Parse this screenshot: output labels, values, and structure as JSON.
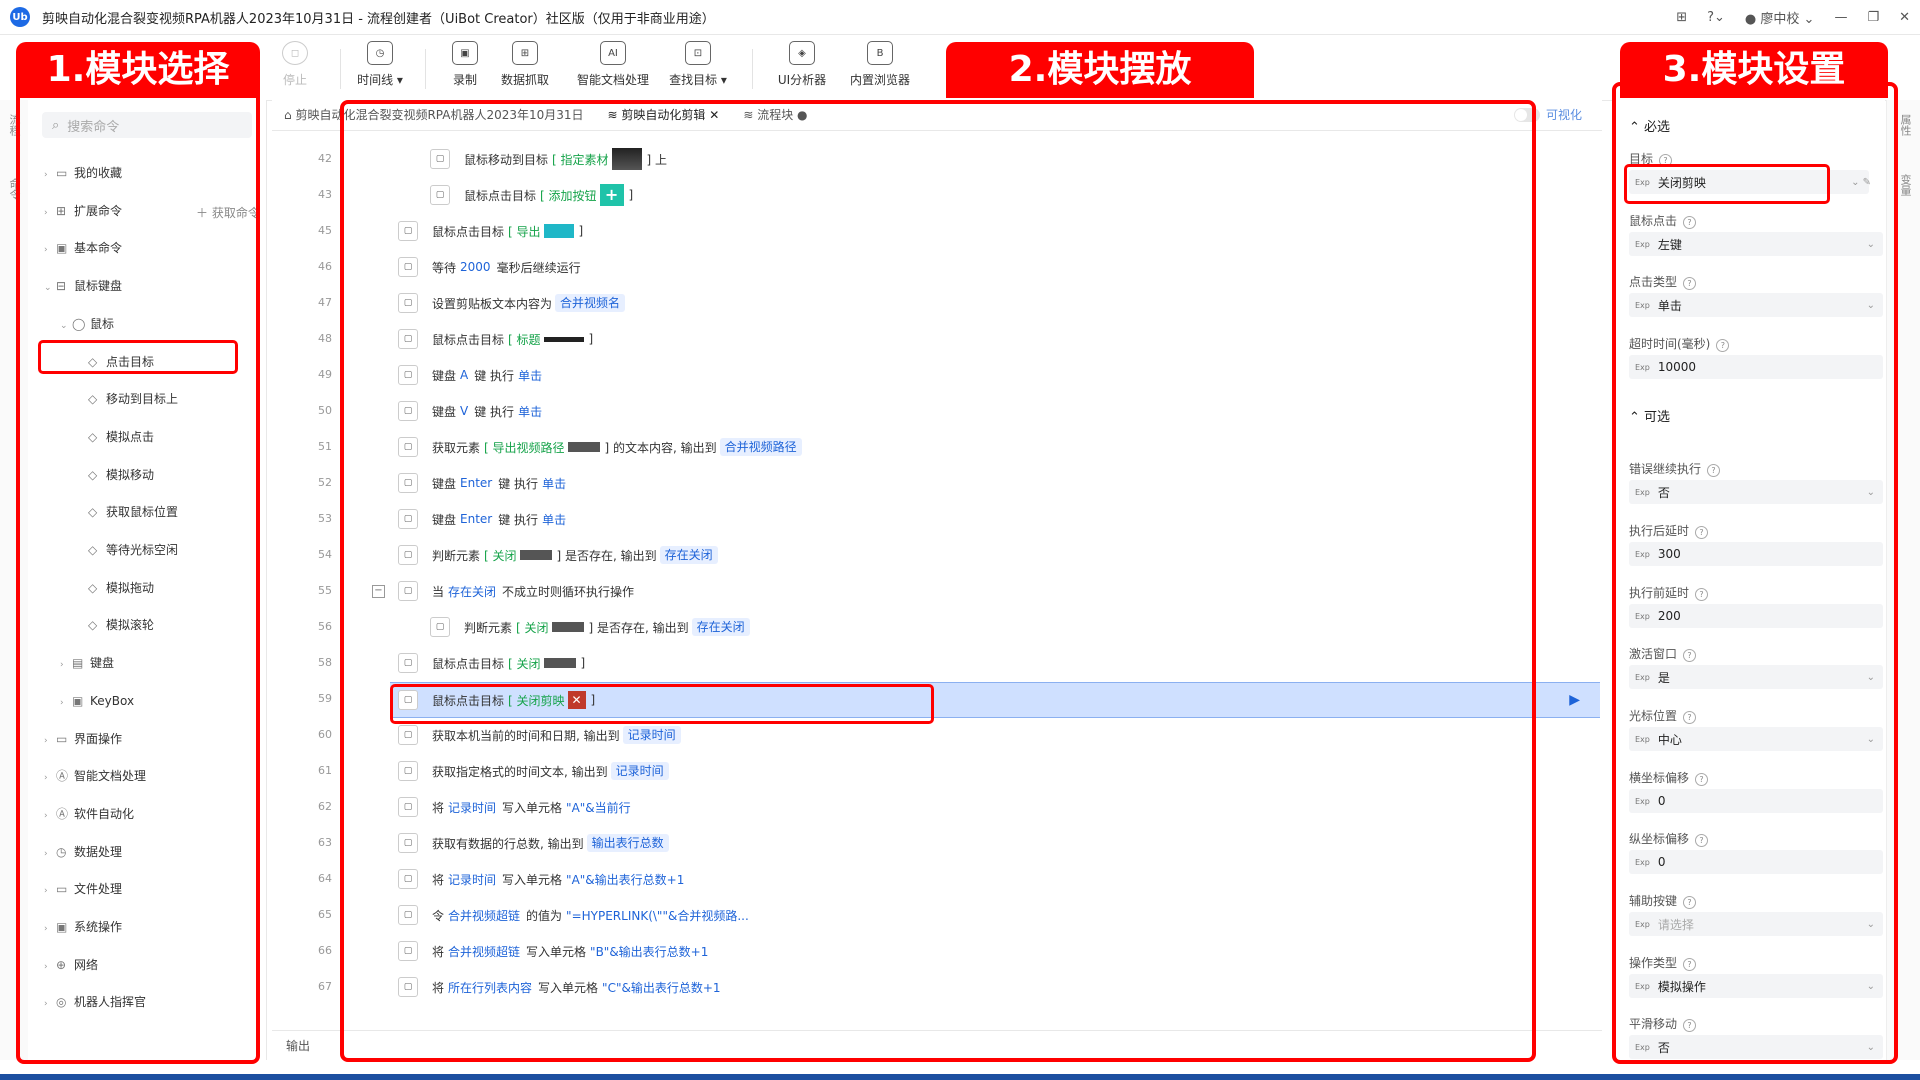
{
  "window": {
    "title": "剪映自动化混合裂变视频RPA机器人2023年10月31日 - 流程创建者（UiBot Creator）社区版（仅用于非商业用途）",
    "logo": "Ub",
    "user": "廖中校"
  },
  "toolbar": {
    "stop": "停止",
    "timeline": "时间线",
    "record": "录制",
    "data_capture": "数据抓取",
    "smart_doc": "智能文档处理",
    "find_target": "查找目标",
    "ui_analyzer": "UI分析器",
    "browser": "内置浏览器",
    "icons": {
      "timeline": "◷",
      "record": "▣",
      "data_capture": "⊞",
      "smart_doc": "AI",
      "find_target": "⊡",
      "ui_analyzer": "◈",
      "browser": "B"
    }
  },
  "annotations": {
    "left": "1.模块选择",
    "center": "2.模块摆放",
    "right": "3.模块设置"
  },
  "left_panel": {
    "search_placeholder": "搜索命令",
    "get_command": "获取命令",
    "tabs": [
      "流程",
      "命令"
    ],
    "tree": [
      {
        "label": "我的收藏",
        "arrow": "›",
        "icon": "▭"
      },
      {
        "label": "扩展命令",
        "arrow": "›",
        "icon": "⊞"
      },
      {
        "label": "基本命令",
        "arrow": "›",
        "icon": "▣"
      },
      {
        "label": "鼠标键盘",
        "arrow": "⌄",
        "icon": "⊟"
      },
      {
        "label": "鼠标",
        "arrow": "⌄",
        "icon": "◯"
      },
      {
        "label": "点击目标",
        "arrow": "",
        "icon": "◇"
      },
      {
        "label": "移动到目标上",
        "arrow": "",
        "icon": "◇"
      },
      {
        "label": "模拟点击",
        "arrow": "",
        "icon": "◇"
      },
      {
        "label": "模拟移动",
        "arrow": "",
        "icon": "◇"
      },
      {
        "label": "获取鼠标位置",
        "arrow": "",
        "icon": "◇"
      },
      {
        "label": "等待光标空闲",
        "arrow": "",
        "icon": "◇"
      },
      {
        "label": "模拟拖动",
        "arrow": "",
        "icon": "◇"
      },
      {
        "label": "模拟滚轮",
        "arrow": "",
        "icon": "◇"
      },
      {
        "label": "键盘",
        "arrow": "›",
        "icon": "▤"
      },
      {
        "label": "KeyBox",
        "arrow": "›",
        "icon": "▣"
      },
      {
        "label": "界面操作",
        "arrow": "›",
        "icon": "▭"
      },
      {
        "label": "智能文档处理",
        "arrow": "›",
        "icon": "Ⓐ"
      },
      {
        "label": "软件自动化",
        "arrow": "›",
        "icon": "Ⓐ"
      },
      {
        "label": "数据处理",
        "arrow": "›",
        "icon": "◷"
      },
      {
        "label": "文件处理",
        "arrow": "›",
        "icon": "▭"
      },
      {
        "label": "系统操作",
        "arrow": "›",
        "icon": "▣"
      },
      {
        "label": "网络",
        "arrow": "›",
        "icon": "⊕"
      },
      {
        "label": "机器人指挥官",
        "arrow": "›",
        "icon": "◎"
      }
    ]
  },
  "editor": {
    "tabs": [
      "剪映自动化混合裂变视频RPA机器人2023年10月31日",
      "剪映自动化剪辑",
      "流程块"
    ],
    "visual_toggle": "可视化",
    "output_label": "输出",
    "rows": [
      {
        "line": "42",
        "pre": "鼠标移动到目标",
        "target": "[ 指定素材",
        "thumb": "photo",
        "post": "] 上",
        "indent": 1
      },
      {
        "line": "43",
        "pre": "鼠标点击目标",
        "target": "[ 添加按钮",
        "thumb": "plus",
        "post": "]",
        "indent": 1
      },
      {
        "line": "45",
        "pre": "鼠标点击目标",
        "target": "[ 导出",
        "thumb": "btn",
        "post": "]",
        "indent": 0
      },
      {
        "line": "46",
        "pre": "等待",
        "kw": "2000",
        "post": "毫秒后继续运行",
        "indent": 0
      },
      {
        "line": "47",
        "pre": "设置剪贴板文本内容为",
        "chip": "合并视频名",
        "indent": 0
      },
      {
        "line": "48",
        "pre": "鼠标点击目标",
        "target": "[ 标题",
        "thumb": "bar",
        "post": "]",
        "indent": 0
      },
      {
        "line": "49",
        "pre": "键盘",
        "kw": "A",
        "post": "键 执行",
        "kw2": "单击",
        "indent": 0
      },
      {
        "line": "50",
        "pre": "键盘",
        "kw": "V",
        "post": "键 执行",
        "kw2": "单击",
        "indent": 0
      },
      {
        "line": "51",
        "pre": "获取元素",
        "target": "[ 导出视频路径",
        "thumb": "dark",
        "post": "] 的文本内容, 输出到",
        "chip": "合并视频路径",
        "indent": 0
      },
      {
        "line": "52",
        "pre": "键盘",
        "kw": "Enter",
        "post": "键 执行",
        "kw2": "单击",
        "indent": 0
      },
      {
        "line": "53",
        "pre": "键盘",
        "kw": "Enter",
        "post": "键 执行",
        "kw2": "单击",
        "indent": 0
      },
      {
        "line": "54",
        "pre": "判断元素",
        "target": "[ 关闭",
        "thumb": "dark",
        "post": "] 是否存在, 输出到",
        "chip": "存在关闭",
        "indent": 0
      },
      {
        "line": "55",
        "pre": "当",
        "kw": "存在关闭",
        "post": "不成立时则循环执行操作",
        "indent": 0,
        "fold": true
      },
      {
        "line": "56",
        "pre": "判断元素",
        "target": "[ 关闭",
        "thumb": "dark",
        "post": "] 是否存在, 输出到",
        "chip": "存在关闭",
        "indent": 1
      },
      {
        "line": "58",
        "pre": "鼠标点击目标",
        "target": "[ 关闭",
        "thumb": "dark",
        "post": "]",
        "indent": 0
      },
      {
        "line": "59",
        "pre": "鼠标点击目标",
        "target": "[ 关闭剪映",
        "thumb": "close",
        "post": "]",
        "indent": 0,
        "selected": true
      },
      {
        "line": "60",
        "pre": "获取本机当前的时间和日期, 输出到",
        "chip": "记录时间",
        "indent": 0
      },
      {
        "line": "61",
        "pre": "获取指定格式的时间文本, 输出到",
        "chip": "记录时间",
        "indent": 0
      },
      {
        "line": "62",
        "pre": "将",
        "kw": "记录时间",
        "post": "写入单元格",
        "kw2": "\"A\"&当前行",
        "indent": 0
      },
      {
        "line": "63",
        "pre": "获取有数据的行总数, 输出到",
        "chip": "输出表行总数",
        "indent": 0
      },
      {
        "line": "64",
        "pre": "将",
        "kw": "记录时间",
        "post": "写入单元格",
        "kw2": "\"A\"&输出表行总数+1",
        "indent": 0
      },
      {
        "line": "65",
        "pre": "令",
        "kw": "合并视频超链",
        "post": "的值为",
        "kw2": "\"=HYPERLINK(\\\"\"&合并视频路...",
        "indent": 0
      },
      {
        "line": "66",
        "pre": "将",
        "kw": "合并视频超链",
        "post": "写入单元格",
        "kw2": "\"B\"&输出表行总数+1",
        "indent": 0
      },
      {
        "line": "67",
        "pre": "将",
        "kw": "所在行列表内容",
        "post": "写入单元格",
        "kw2": "\"C\"&输出表行总数+1",
        "indent": 0
      }
    ]
  },
  "right_panel": {
    "required": "必选",
    "optional": "可选",
    "exp": "Exp",
    "strip": [
      "属性",
      "变量"
    ],
    "fields": [
      {
        "label": "目标",
        "value": "关闭剪映",
        "type": "target"
      },
      {
        "label": "鼠标点击",
        "value": "左键",
        "type": "select"
      },
      {
        "label": "点击类型",
        "value": "单击",
        "type": "select"
      },
      {
        "label": "超时时间(毫秒)",
        "value": "10000",
        "type": "text"
      },
      {
        "label": "错误继续执行",
        "value": "否",
        "type": "select"
      },
      {
        "label": "执行后延时",
        "value": "300",
        "type": "text"
      },
      {
        "label": "执行前延时",
        "value": "200",
        "type": "text"
      },
      {
        "label": "激活窗口",
        "value": "是",
        "type": "select"
      },
      {
        "label": "光标位置",
        "value": "中心",
        "type": "select"
      },
      {
        "label": "横坐标偏移",
        "value": "0",
        "type": "text"
      },
      {
        "label": "纵坐标偏移",
        "value": "0",
        "type": "text"
      },
      {
        "label": "辅助按键",
        "value": "请选择",
        "type": "placeholder"
      },
      {
        "label": "操作类型",
        "value": "模拟操作",
        "type": "select"
      },
      {
        "label": "平滑移动",
        "value": "否",
        "type": "select"
      }
    ]
  },
  "colors": {
    "accent": "#1e63d8",
    "annotation": "#ff0000",
    "selected_row": "#cfe0ff"
  }
}
